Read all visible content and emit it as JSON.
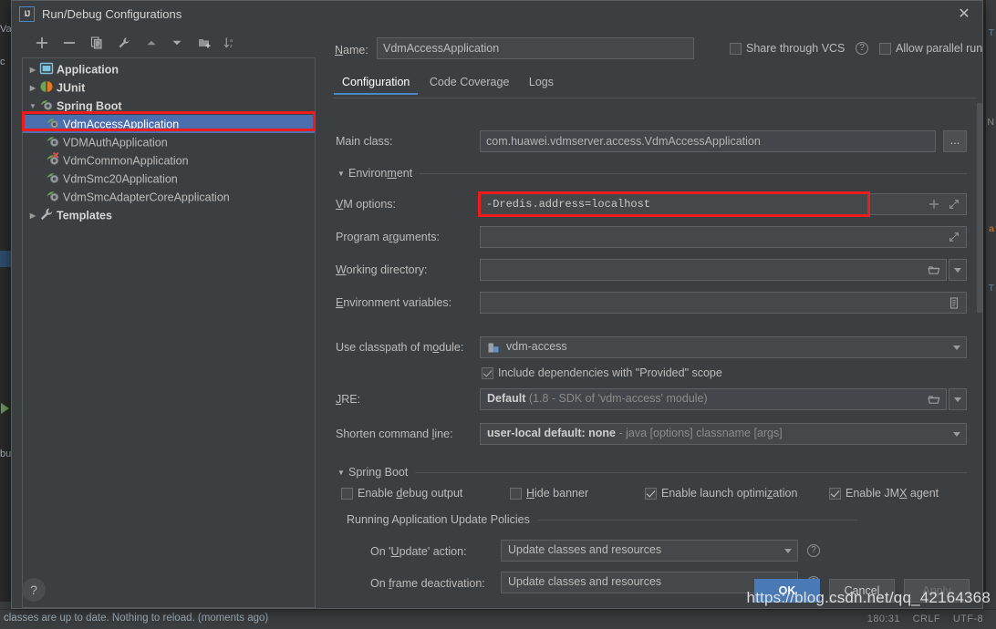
{
  "window": {
    "title": "Run/Debug Configurations",
    "app_icon": "IJ",
    "close_icon": "close-icon"
  },
  "toolbar": {
    "buttons": [
      {
        "name": "add-configuration-button",
        "icon": "plus-icon",
        "title": "Add New Configuration"
      },
      {
        "name": "remove-configuration-button",
        "icon": "minus-icon",
        "title": "Remove Configuration"
      },
      {
        "name": "copy-configuration-button",
        "icon": "copy-icon",
        "title": "Copy Configuration"
      },
      {
        "name": "edit-templates-button",
        "icon": "wrench-icon",
        "title": "Edit Templates"
      },
      {
        "name": "move-up-button",
        "icon": "arrow-up-icon",
        "title": "Move Up"
      },
      {
        "name": "move-down-button",
        "icon": "arrow-down-icon",
        "title": "Move Down"
      },
      {
        "name": "new-folder-button",
        "icon": "folder-add-icon",
        "title": "Create New Folder"
      },
      {
        "name": "sort-configurations-button",
        "icon": "sort-az-icon",
        "title": "Sort Configurations"
      }
    ]
  },
  "tree": {
    "nodes": [
      {
        "label": "Application",
        "level": 0,
        "expanded": false,
        "twisty": "▶",
        "icon": "application-icon",
        "group": true,
        "selected": false
      },
      {
        "label": "JUnit",
        "level": 0,
        "expanded": false,
        "twisty": "▶",
        "icon": "junit-icon",
        "group": true,
        "selected": false
      },
      {
        "label": "Spring Boot",
        "level": 0,
        "expanded": true,
        "twisty": "▼",
        "icon": "spring-boot-icon",
        "group": true,
        "selected": false
      },
      {
        "label": "VdmAccessApplication",
        "level": 1,
        "expanded": null,
        "twisty": "",
        "icon": "spring-boot-icon",
        "group": false,
        "selected": true
      },
      {
        "label": "VDMAuthApplication",
        "level": 1,
        "expanded": null,
        "twisty": "",
        "icon": "spring-boot-icon",
        "group": false,
        "selected": false
      },
      {
        "label": "VdmCommonApplication",
        "level": 1,
        "expanded": null,
        "twisty": "",
        "icon": "spring-boot-error-icon",
        "group": false,
        "selected": false
      },
      {
        "label": "VdmSmc20Application",
        "level": 1,
        "expanded": null,
        "twisty": "",
        "icon": "spring-boot-icon",
        "group": false,
        "selected": false
      },
      {
        "label": "VdmSmcAdapterCoreApplication",
        "level": 1,
        "expanded": null,
        "twisty": "",
        "icon": "spring-boot-icon",
        "group": false,
        "selected": false
      },
      {
        "label": "Templates",
        "level": 0,
        "expanded": false,
        "twisty": "▶",
        "icon": "wrench-icon",
        "group": true,
        "selected": false
      }
    ]
  },
  "header": {
    "name_label": "Name:",
    "name_value": "VdmAccessApplication",
    "share_vcs_label": "Share through VCS",
    "share_vcs_checked": false,
    "share_vcs_help_icon": "help-icon",
    "allow_parallel_label": "Allow parallel run",
    "allow_parallel_checked": false
  },
  "tabs": [
    {
      "label": "Configuration",
      "active": true
    },
    {
      "label": "Code Coverage",
      "active": false
    },
    {
      "label": "Logs",
      "active": false
    }
  ],
  "form": {
    "main_class_label": "Main class:",
    "main_class_value": "com.huawei.vdmserver.access.VdmAccessApplication",
    "main_class_browse_label": "...",
    "environment_section": "Environment",
    "vm_options_label": "VM options:",
    "vm_options_value": "-Dredis.address=localhost",
    "vm_options_add_icon": "plus-icon",
    "vm_options_expand_icon": "expand-icon",
    "program_args_label": "Program arguments:",
    "program_args_value": "",
    "program_args_expand_icon": "expand-icon",
    "working_dir_label": "Working directory:",
    "working_dir_value": "",
    "working_dir_browse_icon": "folder-icon",
    "working_dir_history_icon": "chevron-down-icon",
    "env_vars_label": "Environment variables:",
    "env_vars_value": "",
    "env_vars_edit_icon": "list-edit-icon",
    "classpath_label": "Use classpath of module:",
    "classpath_value": "vdm-access",
    "classpath_icon": "module-icon",
    "include_provided_label": "Include dependencies with \"Provided\" scope",
    "include_provided_checked": true,
    "jre_label": "JRE:",
    "jre_value": "Default",
    "jre_value_hint": "(1.8 - SDK of 'vdm-access' module)",
    "jre_browse_icon": "folder-icon",
    "jre_dropdown_icon": "chevron-down-icon",
    "shorten_cmd_label": "Shorten command line:",
    "shorten_cmd_value": "user-local default: none",
    "shorten_cmd_hint": "- java [options] classname [args]",
    "spring_boot_section": "Spring Boot",
    "enable_debug_label": "Enable debug output",
    "enable_debug_checked": false,
    "hide_banner_label": "Hide banner",
    "hide_banner_checked": false,
    "enable_launch_opt_label": "Enable launch optimization",
    "enable_launch_opt_checked": true,
    "enable_jmx_label": "Enable JMX agent",
    "enable_jmx_checked": true,
    "update_policies_section": "Running Application Update Policies",
    "on_update_label": "On 'Update' action:",
    "on_update_value": "Update classes and resources",
    "on_update_help_icon": "help-icon",
    "on_frame_label": "On frame deactivation:",
    "on_frame_value": "Update classes and resources",
    "on_frame_help_icon": "help-icon"
  },
  "buttons": {
    "help_label": "?",
    "ok_label": "OK",
    "cancel_label": "Cancel",
    "apply_label": "Apply",
    "apply_enabled": false
  },
  "ide_background": {
    "status_message": "classes are up to date. Nothing to reload. (moments ago)",
    "caret_position": "180:31",
    "line_separator": "CRLF",
    "encoding": "UTF-8",
    "left_fragments": [
      "Va",
      "c",
      "bu",
      "class"
    ],
    "right_fragments": [
      "n",
      "T",
      "N",
      "a",
      "T"
    ]
  },
  "watermark": {
    "text": "https://blog.csdn.net/qq_42164368"
  },
  "colors": {
    "accent_blue": "#4a88c7",
    "selection_blue": "#4b6eaf",
    "ok_button": "#4a7ab5",
    "annotation_red": "#ee1c1c",
    "panel_bg": "#3c3f41",
    "field_bg": "#45484a",
    "spring_green": "#6aa84f"
  }
}
